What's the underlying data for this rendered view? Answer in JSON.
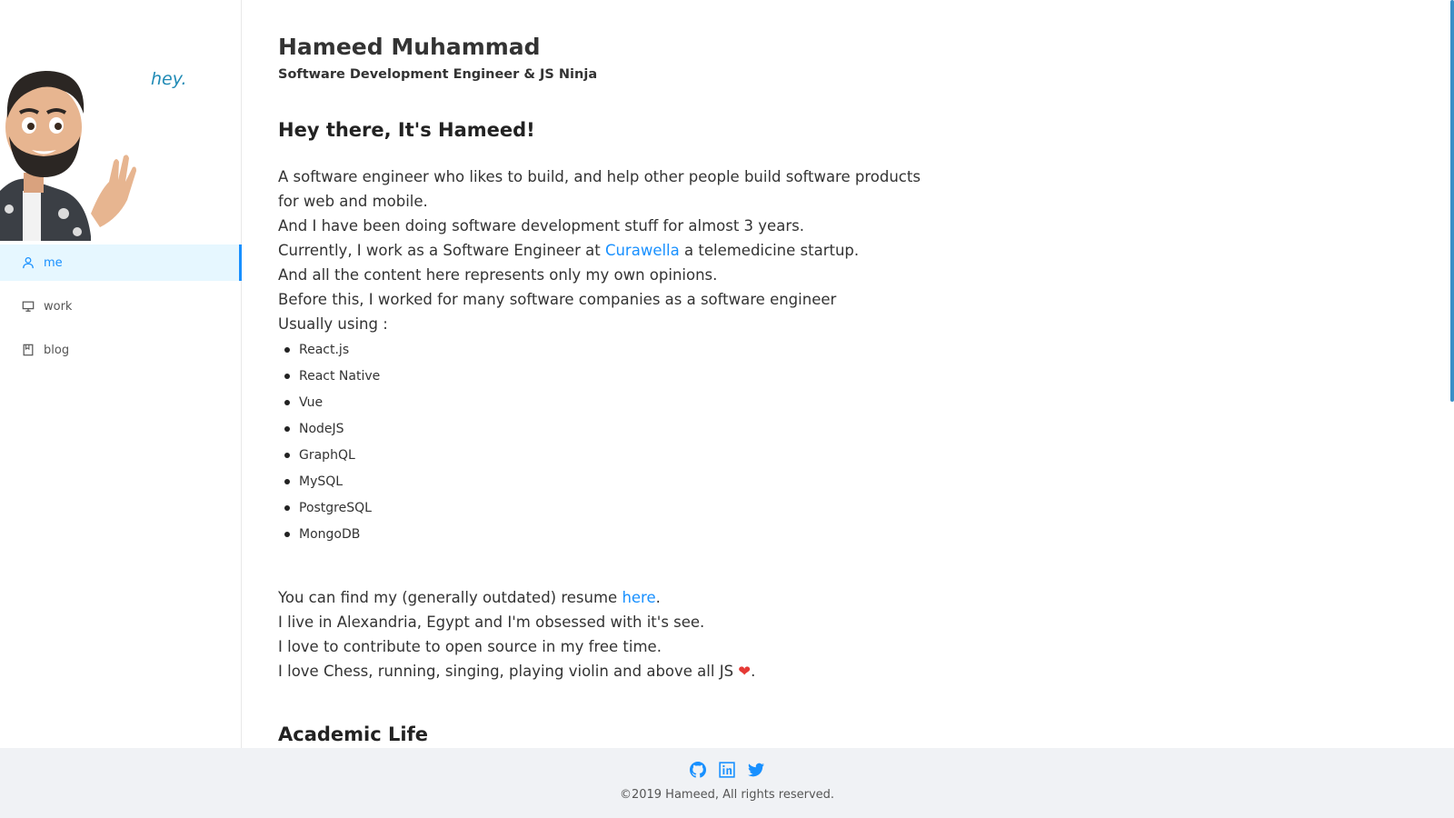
{
  "sidebar": {
    "greeting": "hey.",
    "nav": [
      {
        "label": "me",
        "icon": "user-icon"
      },
      {
        "label": "work",
        "icon": "desktop-icon"
      },
      {
        "label": "blog",
        "icon": "book-icon"
      }
    ]
  },
  "header": {
    "name": "Hameed Muhammad",
    "subtitle": "Software Development Engineer & JS Ninja"
  },
  "intro": {
    "greeting": "Hey there, It's Hameed!",
    "line1": "A software engineer who likes to build, and help other people build software products for web and mobile.",
    "line2": "And I have been doing software development stuff for almost 3 years.",
    "line3_before": "Currently, I work as a Software Engineer at ",
    "line3_link": "Curawella",
    "line3_after": " a telemedicine startup.",
    "line4": "And all the content here represents only my own opinions.",
    "line5": "Before this, I worked for many software companies as a software engineer",
    "line6": "Usually using :"
  },
  "skills": [
    "React.js",
    "React Native",
    "Vue",
    "NodeJS",
    "GraphQL",
    "MySQL",
    "PostgreSQL",
    "MongoDB"
  ],
  "more": {
    "resume_before": "You can find my (generally outdated) resume ",
    "resume_link": "here",
    "resume_after": ".",
    "line2": "I live in Alexandria, Egypt and I'm obsessed with it's see.",
    "line3": "I love to contribute to open source in my free time.",
    "line4_before": "I love Chess, running, singing, playing violin and above all JS ",
    "line4_heart": "❤",
    "line4_after": "."
  },
  "academic": {
    "title": "Academic Life"
  },
  "footer": {
    "social": [
      "github-icon",
      "linkedin-icon",
      "twitter-icon"
    ],
    "copyright": "©2019 Hameed, All rights reserved."
  },
  "colors": {
    "accent": "#1890ff",
    "active_bg": "#e6f7ff",
    "footer_bg": "#f0f2f5",
    "heart": "#e53935"
  }
}
